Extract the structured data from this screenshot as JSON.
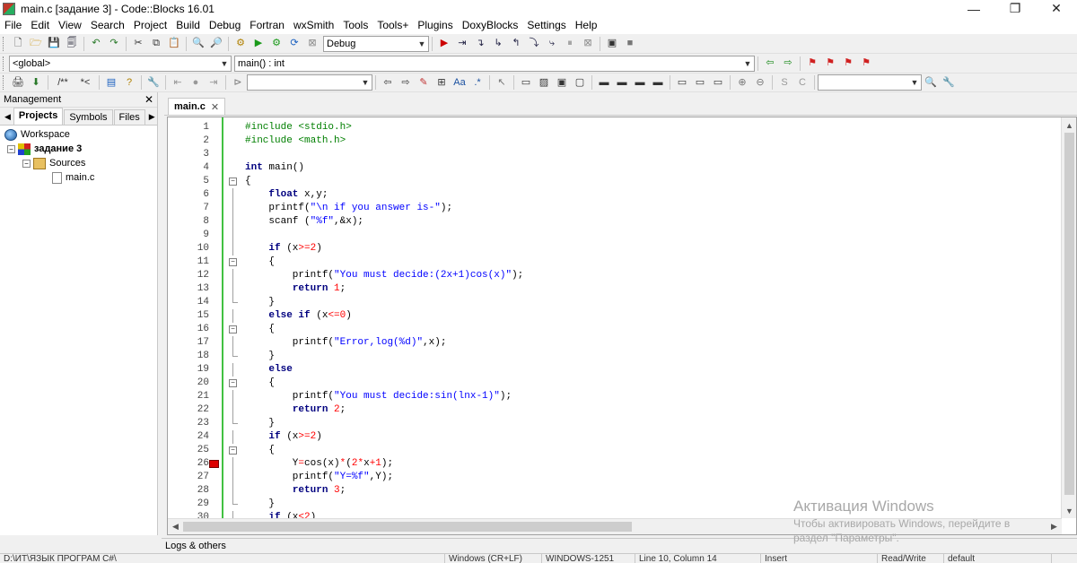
{
  "window": {
    "title": "main.c [задание 3] - Code::Blocks 16.01",
    "minimize": "—",
    "maximize": "❐",
    "close": "✕"
  },
  "menu": [
    "File",
    "Edit",
    "View",
    "Search",
    "Project",
    "Build",
    "Debug",
    "Fortran",
    "wxSmith",
    "Tools",
    "Tools+",
    "Plugins",
    "DoxyBlocks",
    "Settings",
    "Help"
  ],
  "toolbar": {
    "build_target": "Debug",
    "scope": "<global>",
    "function": "main() : int",
    "doxy_comment": "/**",
    "doxy_line": "*<"
  },
  "management": {
    "title": "Management",
    "tabs": [
      "Projects",
      "Symbols",
      "Files"
    ],
    "tree": {
      "workspace": "Workspace",
      "project": "задание 3",
      "folder": "Sources",
      "file": "main.c"
    }
  },
  "editor": {
    "tab_label": "main.c",
    "code_lines": [
      {
        "n": "1",
        "code": "#include <stdio.h>"
      },
      {
        "n": "2",
        "code": "#include <math.h>"
      },
      {
        "n": "3",
        "code": ""
      },
      {
        "n": "4",
        "code": "int main()"
      },
      {
        "n": "5",
        "code": "{"
      },
      {
        "n": "6",
        "code": "    float x,y;"
      },
      {
        "n": "7",
        "code": "    printf(\"\\n if you answer is-\");"
      },
      {
        "n": "8",
        "code": "    scanf (\"%f\",&x);"
      },
      {
        "n": "9",
        "code": ""
      },
      {
        "n": "10",
        "code": "    if (x>=2)"
      },
      {
        "n": "11",
        "code": "    {"
      },
      {
        "n": "12",
        "code": "        printf(\"You must decide:(2x+1)cos(x)\");"
      },
      {
        "n": "13",
        "code": "        return 1;"
      },
      {
        "n": "14",
        "code": "    }"
      },
      {
        "n": "15",
        "code": "    else if (x<=0)"
      },
      {
        "n": "16",
        "code": "    {"
      },
      {
        "n": "17",
        "code": "        printf(\"Error,log(%d)\",x);"
      },
      {
        "n": "18",
        "code": "    }"
      },
      {
        "n": "19",
        "code": "    else"
      },
      {
        "n": "20",
        "code": "    {"
      },
      {
        "n": "21",
        "code": "        printf(\"You must decide:sin(lnx-1)\");"
      },
      {
        "n": "22",
        "code": "        return 2;"
      },
      {
        "n": "23",
        "code": "    }"
      },
      {
        "n": "24",
        "code": "    if (x>=2)"
      },
      {
        "n": "25",
        "code": "    {"
      },
      {
        "n": "26",
        "code": "        Y=cos(x)*(2*x+1);"
      },
      {
        "n": "27",
        "code": "        printf(\"Y=%f\",Y);"
      },
      {
        "n": "28",
        "code": "        return 3;"
      },
      {
        "n": "29",
        "code": "    }"
      },
      {
        "n": "30",
        "code": "    if (x<2)"
      }
    ]
  },
  "logs": {
    "title": "Logs & others"
  },
  "status": {
    "path": "D:\\ИТ\\ЯЗЫК ПРОГРАМ С#\\",
    "lang": "Windows (CR+LF)",
    "encoding": "WINDOWS-1251",
    "position": "Line 10, Column 14",
    "mode": "Insert",
    "rw": "Read/Write",
    "default": "default"
  },
  "activation": {
    "title": "Активация Windows",
    "line1": "Чтобы активировать Windows, перейдите в",
    "line2": "раздел \"Параметры\"."
  },
  "colors": {
    "keyword": "#00007f",
    "preprocessor": "#007f00",
    "string": "#0000ff",
    "number": "#ff0000",
    "breakpoint": "#dd0000",
    "change_bar": "#41c141"
  }
}
